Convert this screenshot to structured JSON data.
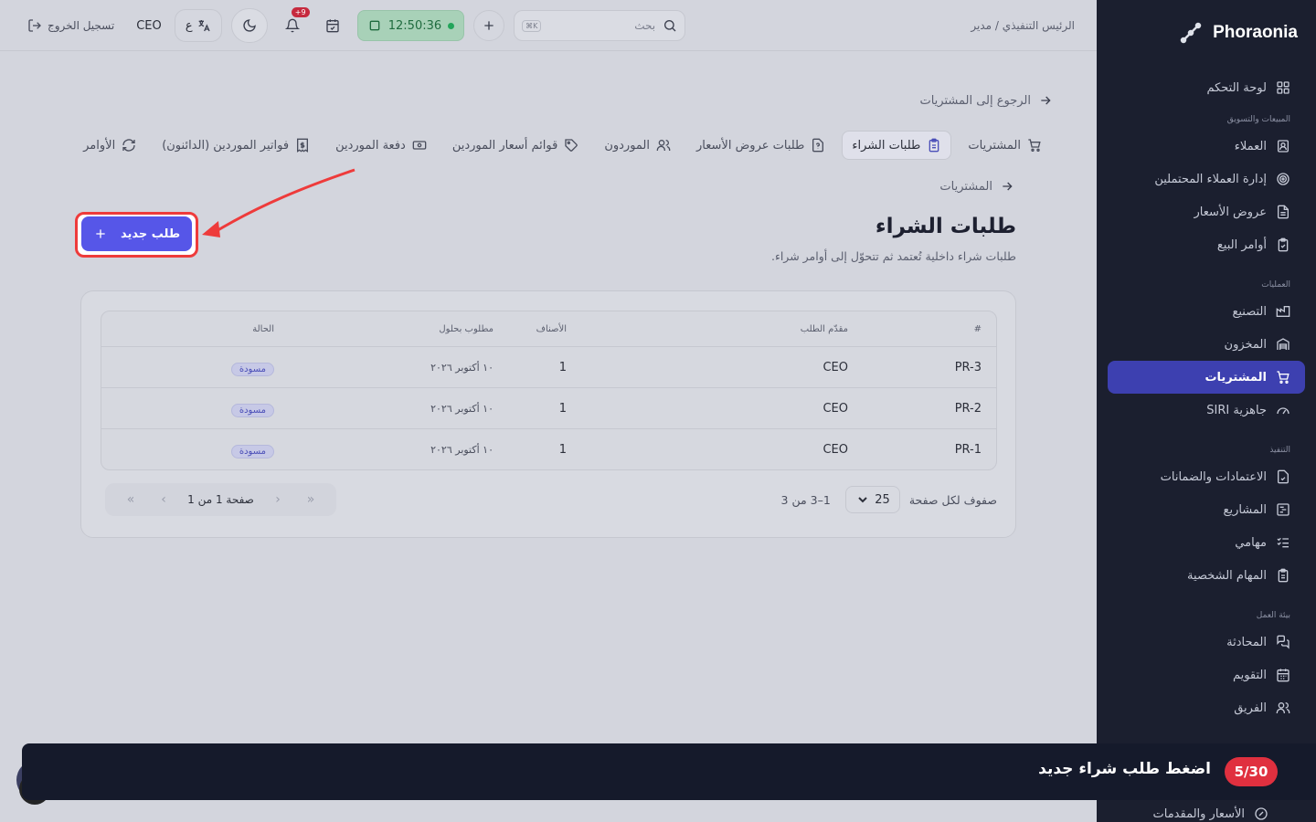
{
  "brand": {
    "name": "Phoraonia"
  },
  "sidebar": {
    "items": [
      {
        "label": "لوحة التحكم",
        "icon": "dashboard-icon"
      },
      {
        "section": "المبيعات والتسويق"
      },
      {
        "label": "العملاء",
        "icon": "contacts-icon"
      },
      {
        "label": "إدارة العملاء المحتملين",
        "icon": "target-icon"
      },
      {
        "label": "عروض الأسعار",
        "icon": "document-icon"
      },
      {
        "label": "أوامر البيع",
        "icon": "clipboard-check-icon"
      },
      {
        "section": "العمليات"
      },
      {
        "label": "التصنيع",
        "icon": "factory-icon"
      },
      {
        "label": "المخزون",
        "icon": "warehouse-icon"
      },
      {
        "label": "المشتريات",
        "icon": "cart-icon",
        "active": true
      },
      {
        "label": "جاهزية SIRI",
        "icon": "gauge-icon"
      },
      {
        "section": "التنفيذ"
      },
      {
        "label": "الاعتمادات والضمانات",
        "icon": "file-check-icon"
      },
      {
        "label": "المشاريع",
        "icon": "gantt-icon"
      },
      {
        "label": "مهامي",
        "icon": "list-check-icon"
      },
      {
        "label": "المهام الشخصية",
        "icon": "clipboard-icon"
      },
      {
        "section": "بيئة العمل"
      },
      {
        "label": "المحادثة",
        "icon": "chat-icon"
      },
      {
        "label": "التقويم",
        "icon": "calendar-icon"
      },
      {
        "label": "الفريق",
        "icon": "users-icon"
      }
    ],
    "bottom_label": "الأسعار والمقدمات"
  },
  "topbar": {
    "breadcrumb": "الرئيس التنفيذي / مدير",
    "search_placeholder": "بحث",
    "search_kbd": "K⌘",
    "clock": "12:50:36",
    "notifications_badge": "+9",
    "lang_label": "ع",
    "user": "CEO",
    "logout": "تسجيل الخروج"
  },
  "back_link": "الرجوع إلى المشتريات",
  "tabs": [
    {
      "label": "المشتريات",
      "icon": "cart-icon"
    },
    {
      "label": "طلبات الشراء",
      "icon": "clipboard-icon",
      "active": true
    },
    {
      "label": "طلبات عروض الأسعار",
      "icon": "file-question-icon"
    },
    {
      "label": "الموردون",
      "icon": "users-icon"
    },
    {
      "label": "قوائم أسعار الموردين",
      "icon": "tag-icon"
    },
    {
      "label": "دفعة الموردين",
      "icon": "banknote-icon"
    },
    {
      "label": "فواتير الموردين (الدائنون)",
      "icon": "receipt-icon"
    },
    {
      "label": "الأوامر",
      "icon": "refresh-icon"
    }
  ],
  "sub_breadcrumb": "المشتريات",
  "page": {
    "title": "طلبات الشراء",
    "subtitle": "طلبات شراء داخلية تُعتمد ثم تتحوّل إلى أوامر شراء."
  },
  "new_button": {
    "label": "طلب جديد",
    "icon": "plus-icon"
  },
  "table": {
    "headers": {
      "id": "#",
      "requester": "مقدّم الطلب",
      "items": "الأصناف",
      "due": "مطلوب بحلول",
      "status": "الحالة"
    },
    "rows": [
      {
        "id": "PR-3",
        "requester": "CEO",
        "items": "1",
        "due": "١٠ أكتوبر ٢٠٢٦",
        "status": "مسودة"
      },
      {
        "id": "PR-2",
        "requester": "CEO",
        "items": "1",
        "due": "١٠ أكتوبر ٢٠٢٦",
        "status": "مسودة"
      },
      {
        "id": "PR-1",
        "requester": "CEO",
        "items": "1",
        "due": "١٠ أكتوبر ٢٠٢٦",
        "status": "مسودة"
      }
    ]
  },
  "pagination": {
    "rows_per_page_label": "صفوف لكل صفحة",
    "rows_per_page": "25",
    "range": "1–3 من 3",
    "page_label": "صفحة 1 من 1"
  },
  "tour": {
    "step": "5/30",
    "message": "اضغط طلب شراء جديد"
  },
  "colors": {
    "accent": "#5656e8",
    "sidebar_bg": "#1b1f2f",
    "highlight": "#ee3b3b",
    "tour_bg": "#151a2b"
  }
}
